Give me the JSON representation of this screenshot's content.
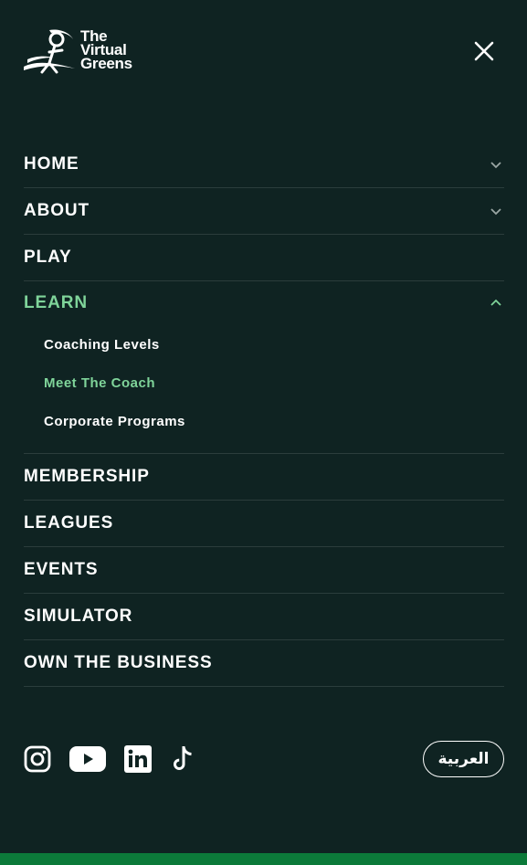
{
  "logo": {
    "line1": "The",
    "line2": "Virtual",
    "line3": "Greens"
  },
  "nav": {
    "items": [
      {
        "label": "HOME"
      },
      {
        "label": "ABOUT"
      },
      {
        "label": "PLAY"
      },
      {
        "label": "LEARN"
      },
      {
        "label": "MEMBERSHIP"
      },
      {
        "label": "LEAGUES"
      },
      {
        "label": "EVENTS"
      },
      {
        "label": "SIMULATOR"
      },
      {
        "label": "OWN THE BUSINESS"
      }
    ],
    "learn_sub": [
      {
        "label": "Coaching Levels"
      },
      {
        "label": "Meet The Coach"
      },
      {
        "label": "Corporate Programs"
      }
    ]
  },
  "social": [
    "instagram-icon",
    "youtube-icon",
    "linkedin-icon",
    "tiktok-icon"
  ],
  "language_button": "العربية",
  "colors": {
    "background": "#0f2322",
    "accent": "#7fd49a",
    "divider": "#2b3d3c",
    "bottom_bar": "#0c7a3a"
  }
}
